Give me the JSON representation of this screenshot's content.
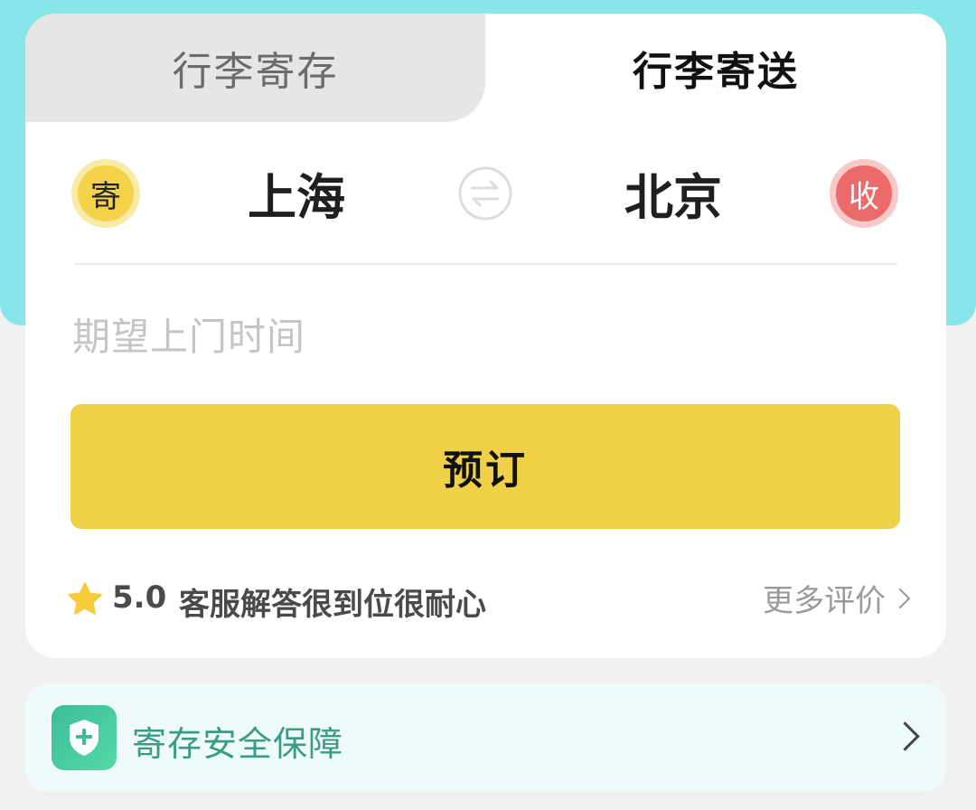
{
  "tabs": {
    "storage_label": "行李寄存",
    "delivery_label": "行李寄送"
  },
  "route": {
    "send_badge": "寄",
    "from_city": "上海",
    "to_city": "北京",
    "receive_badge": "收"
  },
  "pickup_time": {
    "placeholder": "期望上门时间"
  },
  "actions": {
    "book_label": "预订"
  },
  "review": {
    "score": "5.0",
    "text": "客服解答很到位很耐心",
    "more_label": "更多评价"
  },
  "safety": {
    "label": "寄存安全保障"
  },
  "colors": {
    "header_bg": "#86e6ea",
    "accent_yellow": "#f0d046",
    "receive_red": "#ed6a6a",
    "safety_green": "#3a9c86"
  },
  "icons": {
    "swap": "swap-arrows-icon",
    "star": "star-icon",
    "shield": "shield-plus-icon",
    "chevron": "chevron-right-icon"
  }
}
